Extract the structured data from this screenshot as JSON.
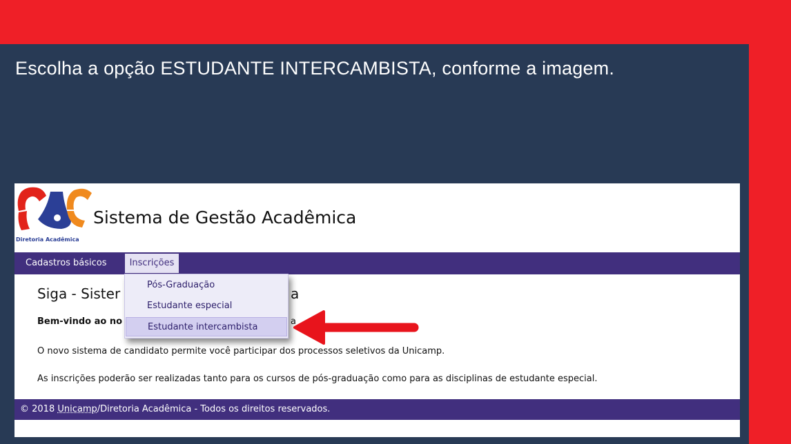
{
  "instruction": "Escolha a opção ESTUDANTE INTERCAMBISTA, conforme a imagem.",
  "header": {
    "logo_text": "Diretoria Acadêmica",
    "title": "Sistema de Gestão Acadêmica"
  },
  "nav": {
    "items": [
      {
        "label": "Cadastros básicos"
      },
      {
        "label": "Inscrições"
      }
    ]
  },
  "dropdown": {
    "items": [
      {
        "label": "Pós-Graduação"
      },
      {
        "label": "Estudante especial"
      },
      {
        "label": "Estudante intercambista"
      }
    ],
    "highlighted": "Estudante intercambista"
  },
  "content": {
    "title_start": "Siga - Sister",
    "title_end": "a",
    "welcome_start": "Bem-vindo ao no",
    "welcome_end": "a",
    "para1": "O novo sistema de candidato permite você participar dos processos seletivos da Unicamp.",
    "para2": "As inscrições poderão ser realizadas tanto para os cursos de pós-graduação como para as disciplinas de estudante especial."
  },
  "footer": {
    "copy": "© 2018 ",
    "link": "Unicamp",
    "rest": "/Diretoria Acadêmica - Todos os direitos reservados."
  },
  "colors": {
    "outer_red": "#ef1f27",
    "panel_navy": "#283a55",
    "nav_purple": "#412f7e",
    "arrow_red": "#e8141c"
  },
  "icons": {
    "arrow": "red-arrow-pointing-left"
  }
}
